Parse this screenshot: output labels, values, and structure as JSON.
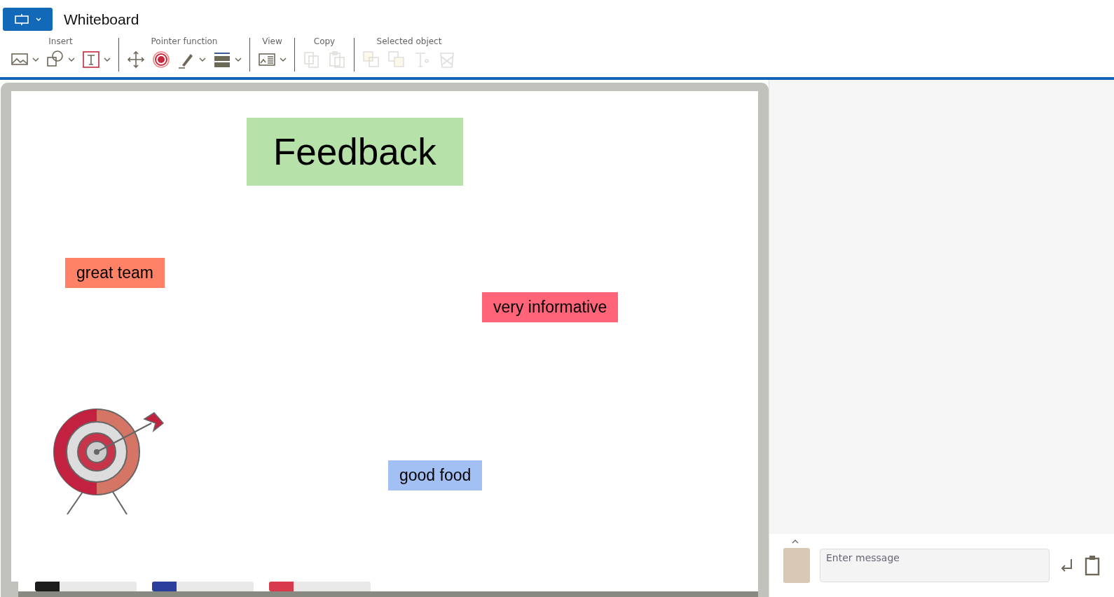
{
  "window": {
    "title": "Whiteboard"
  },
  "toolbar_groups": [
    {
      "label": "Insert",
      "tools": [
        {
          "disabled": false,
          "has_menu": true
        },
        {
          "disabled": false,
          "has_menu": true
        },
        {
          "disabled": false,
          "has_menu": true
        }
      ]
    },
    {
      "label": "Pointer function",
      "tools": [
        {
          "disabled": false,
          "has_menu": false
        },
        {
          "disabled": false,
          "has_menu": false
        },
        {
          "disabled": false,
          "has_menu": true
        },
        {
          "disabled": false,
          "has_menu": true
        }
      ]
    },
    {
      "label": "View",
      "tools": [
        {
          "disabled": false,
          "has_menu": true
        }
      ]
    },
    {
      "label": "Copy",
      "tools": [
        {
          "disabled": true,
          "has_menu": false
        },
        {
          "disabled": true,
          "has_menu": false
        }
      ]
    },
    {
      "label": "Selected object",
      "tools": [
        {
          "disabled": true,
          "has_menu": false
        },
        {
          "disabled": true,
          "has_menu": false
        },
        {
          "disabled": true,
          "has_menu": false
        },
        {
          "disabled": true,
          "has_menu": false
        }
      ]
    }
  ],
  "notes": [
    {
      "text": "Feedback",
      "color": "#b6e2aa"
    },
    {
      "text": "great team",
      "color": "#ff8266"
    },
    {
      "text": "very informative",
      "color": "#ff6479"
    },
    {
      "text": "good food",
      "color": "#a2c0f4"
    }
  ],
  "markers": [
    {
      "color": "#1c1c1c"
    },
    {
      "color": "#2a3f9c"
    },
    {
      "color": "#d83a4c"
    }
  ],
  "chat": {
    "placeholder": "Enter message"
  }
}
